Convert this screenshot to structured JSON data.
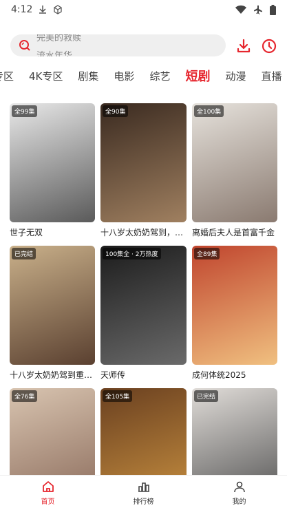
{
  "status": {
    "time": "4:12"
  },
  "search": {
    "hints": [
      "完美的救赎",
      "流水年华"
    ]
  },
  "tabs": [
    "专区",
    "4K专区",
    "剧集",
    "电影",
    "综艺",
    "短剧",
    "动漫",
    "直播"
  ],
  "active_tab_index": 5,
  "cards": [
    {
      "badge": "全99集",
      "title": "世子无双",
      "colors": [
        "#e8e8e8",
        "#5a5a5a"
      ]
    },
    {
      "badge": "全90集",
      "title": "十八岁太奶奶驾到，…",
      "colors": [
        "#3a2a20",
        "#a08060"
      ]
    },
    {
      "badge": "全100集",
      "title": "离婚后夫人是首富千金",
      "colors": [
        "#e6e2dc",
        "#8a7a70"
      ]
    },
    {
      "badge": "已完结",
      "title": "十八岁太奶奶驾到重…",
      "colors": [
        "#c9b08a",
        "#5a4030"
      ]
    },
    {
      "badge": "100集全 · 2万热度",
      "title": "天师传",
      "colors": [
        "#1c1c1c",
        "#6a6a6a"
      ]
    },
    {
      "badge": "全89集",
      "title": "成何体统2025",
      "colors": [
        "#c0452e",
        "#f0c080"
      ]
    },
    {
      "badge": "全76集",
      "title": "",
      "colors": [
        "#d8c4b0",
        "#8a6a5a"
      ]
    },
    {
      "badge": "全105集",
      "title": "",
      "colors": [
        "#6a4020",
        "#c89040"
      ]
    },
    {
      "badge": "已完结",
      "title": "",
      "colors": [
        "#e0dcd8",
        "#505050"
      ]
    }
  ],
  "nav": [
    {
      "label": "首页",
      "icon": "home-icon",
      "active": true
    },
    {
      "label": "排行榜",
      "icon": "ranking-icon",
      "active": false
    },
    {
      "label": "我的",
      "icon": "profile-icon",
      "active": false
    }
  ],
  "colors": {
    "accent": "#e6262e"
  }
}
